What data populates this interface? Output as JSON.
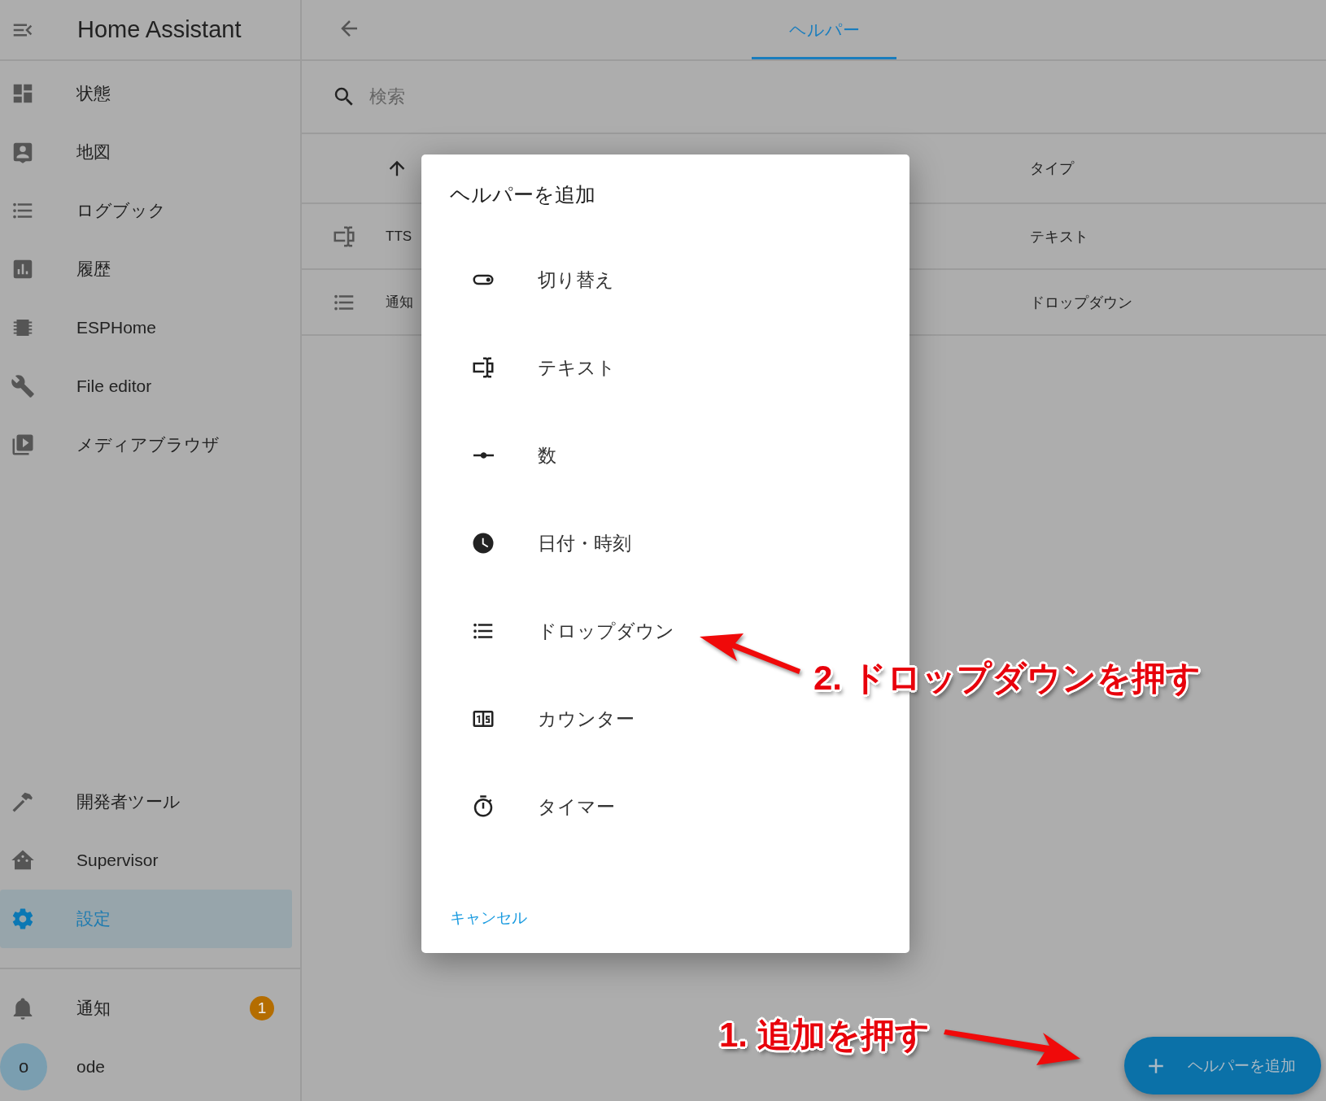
{
  "app_title": "Home Assistant",
  "sidebar": {
    "items": [
      {
        "label": "状態",
        "selected": false
      },
      {
        "label": "地図",
        "selected": false
      },
      {
        "label": "ログブック",
        "selected": false
      },
      {
        "label": "履歴",
        "selected": false
      },
      {
        "label": "ESPHome",
        "selected": false
      },
      {
        "label": "File editor",
        "selected": false
      },
      {
        "label": "メディアブラウザ",
        "selected": false
      }
    ],
    "bottom_items": [
      {
        "label": "開発者ツール",
        "selected": false
      },
      {
        "label": "Supervisor",
        "selected": false
      },
      {
        "label": "設定",
        "selected": true
      }
    ],
    "notifications": {
      "label": "通知",
      "badge": "1"
    },
    "user": {
      "initial": "o",
      "name": "ode"
    }
  },
  "tabs": [
    {
      "label": "ヘルパー",
      "selected": true
    }
  ],
  "search": {
    "placeholder": "検索"
  },
  "table": {
    "columns": [
      {
        "label": "タイプ"
      }
    ],
    "rows": [
      {
        "name": "TTS",
        "type": "テキスト"
      },
      {
        "name": "通知",
        "type": "ドロップダウン"
      }
    ]
  },
  "dialog": {
    "title": "ヘルパーを追加",
    "items": [
      {
        "label": "切り替え"
      },
      {
        "label": "テキスト"
      },
      {
        "label": "数"
      },
      {
        "label": "日付・時刻"
      },
      {
        "label": "ドロップダウン"
      },
      {
        "label": "カウンター"
      },
      {
        "label": "タイマー"
      }
    ],
    "cancel": "キャンセル"
  },
  "fab": {
    "label": "ヘルパーを追加"
  },
  "annotations": [
    {
      "text": "1. 追加を押す"
    },
    {
      "text": "2. ドロップダウンを押す"
    }
  ]
}
